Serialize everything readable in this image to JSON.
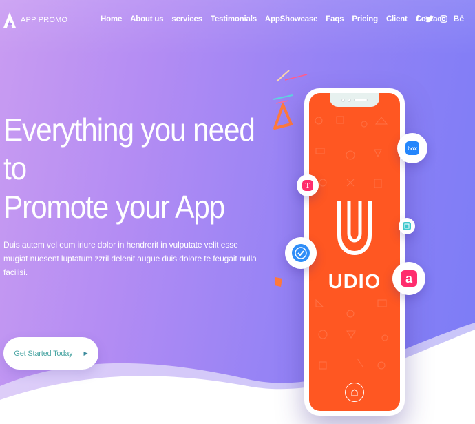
{
  "brand": {
    "name": "APP PROMO"
  },
  "nav": {
    "items": [
      "Home",
      "About us",
      "services",
      "Testimonials",
      "AppShowcase",
      "Faqs",
      "Pricing",
      "Client",
      "Contact"
    ]
  },
  "social": {
    "facebook": "f",
    "twitter": "🐦",
    "instagram": "◎",
    "behance": "Bē"
  },
  "hero": {
    "title_line1": "Everything you need to",
    "title_line2": "Promote your App",
    "description": "Duis autem vel eum iriure dolor in hendrerit in vulputate velit esse mugiat nuesent luptatum zzril delenit augue duis dolore te feugait nulla facilisi.",
    "cta_label": "Get Started Today",
    "cta_arrow": "▶"
  },
  "phone": {
    "app_name": "UDIO",
    "screen_color": "#ff5722"
  },
  "badges": {
    "box": "box",
    "t": "T",
    "a": "a"
  },
  "colors": {
    "accent": "#4ca6a4",
    "background_start": "#c99cf2",
    "background_end": "#7b7cf6"
  }
}
